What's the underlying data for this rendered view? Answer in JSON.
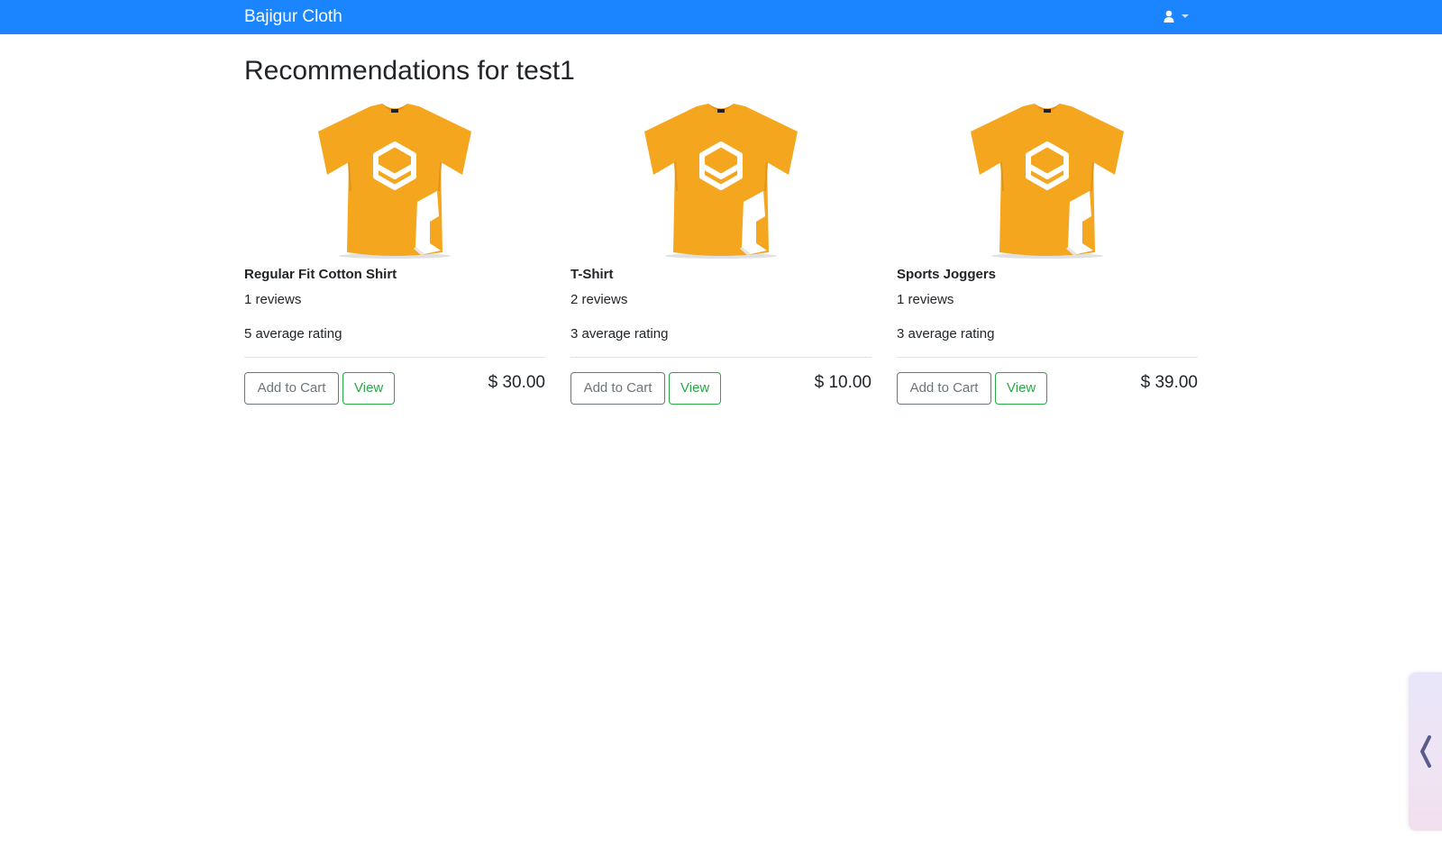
{
  "navbar": {
    "brand": "Bajigur Cloth",
    "user_icon": "user-icon",
    "caret_icon": "caret-down-icon",
    "color": "#1a85ff"
  },
  "page": {
    "title": "Recommendations for test1"
  },
  "products": [
    {
      "name": "Regular Fit Cotton Shirt",
      "reviews": "1 reviews",
      "rating": "5 average rating",
      "price": "$ 30.00",
      "add_label": "Add to Cart",
      "view_label": "View",
      "image_icon": "tshirt-image"
    },
    {
      "name": "T-Shirt",
      "reviews": "2 reviews",
      "rating": "3 average rating",
      "price": "$ 10.00",
      "add_label": "Add to Cart",
      "view_label": "View",
      "image_icon": "tshirt-image"
    },
    {
      "name": "Sports Joggers",
      "reviews": "1 reviews",
      "rating": "3 average rating",
      "price": "$ 39.00",
      "add_label": "Add to Cart",
      "view_label": "View",
      "image_icon": "tshirt-image"
    }
  ],
  "side_tab": {
    "icon": "chevron-left-icon"
  },
  "colors": {
    "shirt": "#f5a623",
    "view_button": "#28a745",
    "cart_button": "#6c757d"
  }
}
